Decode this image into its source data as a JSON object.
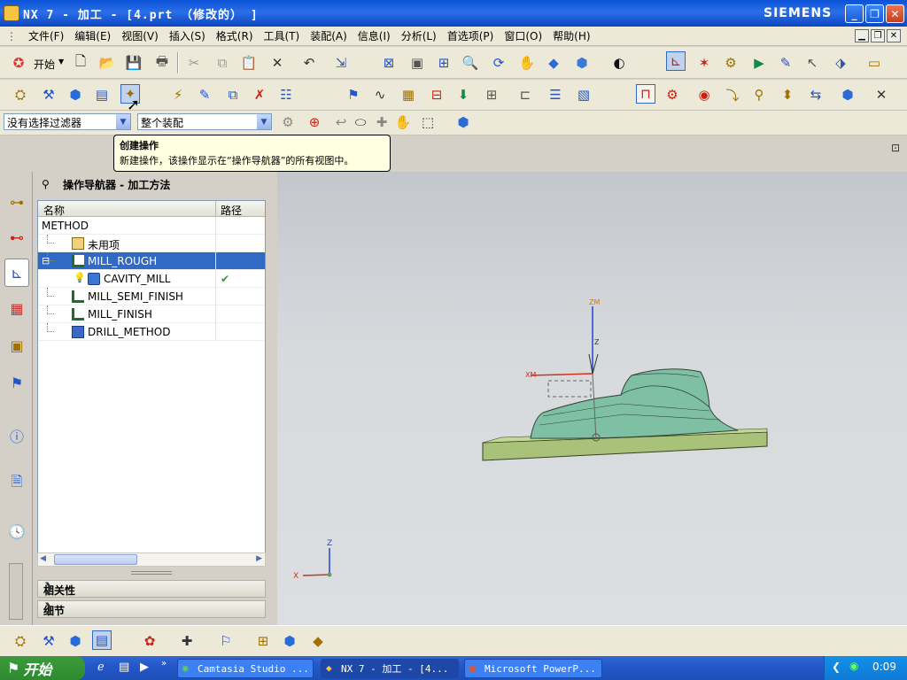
{
  "window": {
    "title": "NX 7 - 加工 - [4.prt （修改的） ]",
    "brand": "SIEMENS",
    "controls": [
      "_",
      "❐",
      "✕"
    ]
  },
  "menu": [
    "文件(F)",
    "编辑(E)",
    "视图(V)",
    "插入(S)",
    "格式(R)",
    "工具(T)",
    "装配(A)",
    "信息(I)",
    "分析(L)",
    "首选项(P)",
    "窗口(O)",
    "帮助(H)"
  ],
  "toolbar": {
    "start_label": "开始"
  },
  "filters": {
    "selection_filter": "没有选择过滤器",
    "assembly_scope": "整个装配"
  },
  "tooltip": {
    "title": "创建操作",
    "body": "新建操作，该操作显示在“操作导航器”的所有视图中。"
  },
  "navigator": {
    "title": "操作导航器 - 加工方法",
    "col_name": "名称",
    "col_path": "路径",
    "rows": [
      {
        "label": "METHOD",
        "indent": 0,
        "icon": "none",
        "path": ""
      },
      {
        "label": "未用项",
        "indent": 1,
        "icon": "unused-icon",
        "path": ""
      },
      {
        "label": "MILL_ROUGH",
        "indent": 1,
        "icon": "method-icon",
        "path": "",
        "selected": true
      },
      {
        "label": "CAVITY_MILL",
        "indent": 2,
        "icon": "cavity-mill-icon",
        "path": "✔"
      },
      {
        "label": "MILL_SEMI_FINISH",
        "indent": 1,
        "icon": "method-icon",
        "path": ""
      },
      {
        "label": "MILL_FINISH",
        "indent": 1,
        "icon": "method-icon",
        "path": ""
      },
      {
        "label": "DRILL_METHOD",
        "indent": 1,
        "icon": "drill-icon",
        "path": ""
      }
    ],
    "section_dependencies": "相关性",
    "section_details": "细节"
  },
  "viewport": {
    "axis_z": "Z",
    "axis_x": "X"
  },
  "taskbar": {
    "start": "开始",
    "tasks": [
      {
        "label": "Camtasia Studio ..."
      },
      {
        "label": "NX 7 - 加工 - [4..."
      },
      {
        "label": "Microsoft PowerP..."
      }
    ],
    "clock": "0:09"
  }
}
